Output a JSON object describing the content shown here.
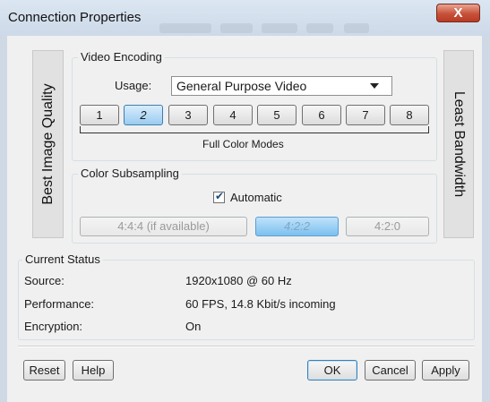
{
  "window": {
    "title": "Connection Properties",
    "close_glyph": "X"
  },
  "quality": {
    "left_label": "Best Image Quality",
    "right_label": "Least Bandwidth"
  },
  "video_encoding": {
    "group_title": "Video Encoding",
    "usage_label": "Usage:",
    "usage_value": "General Purpose Video",
    "modes": [
      "1",
      "2",
      "3",
      "4",
      "5",
      "6",
      "7",
      "8"
    ],
    "selected_mode": "2",
    "modes_caption": "Full Color Modes"
  },
  "color_subsampling": {
    "group_title": "Color Subsampling",
    "automatic_label": "Automatic",
    "automatic_checked": true,
    "options": [
      "4:4:4 (if available)",
      "4:2:2",
      "4:2:0"
    ],
    "selected_option": "4:2:2"
  },
  "current_status": {
    "group_title": "Current Status",
    "rows": [
      {
        "label": "Source:",
        "value": "1920x1080 @ 60 Hz"
      },
      {
        "label": "Performance:",
        "value": "60 FPS, 14.8 Kbit/s incoming"
      },
      {
        "label": "Encryption:",
        "value": "On"
      }
    ]
  },
  "buttons": {
    "reset": "Reset",
    "help": "Help",
    "ok": "OK",
    "cancel": "Cancel",
    "apply": "Apply"
  }
}
